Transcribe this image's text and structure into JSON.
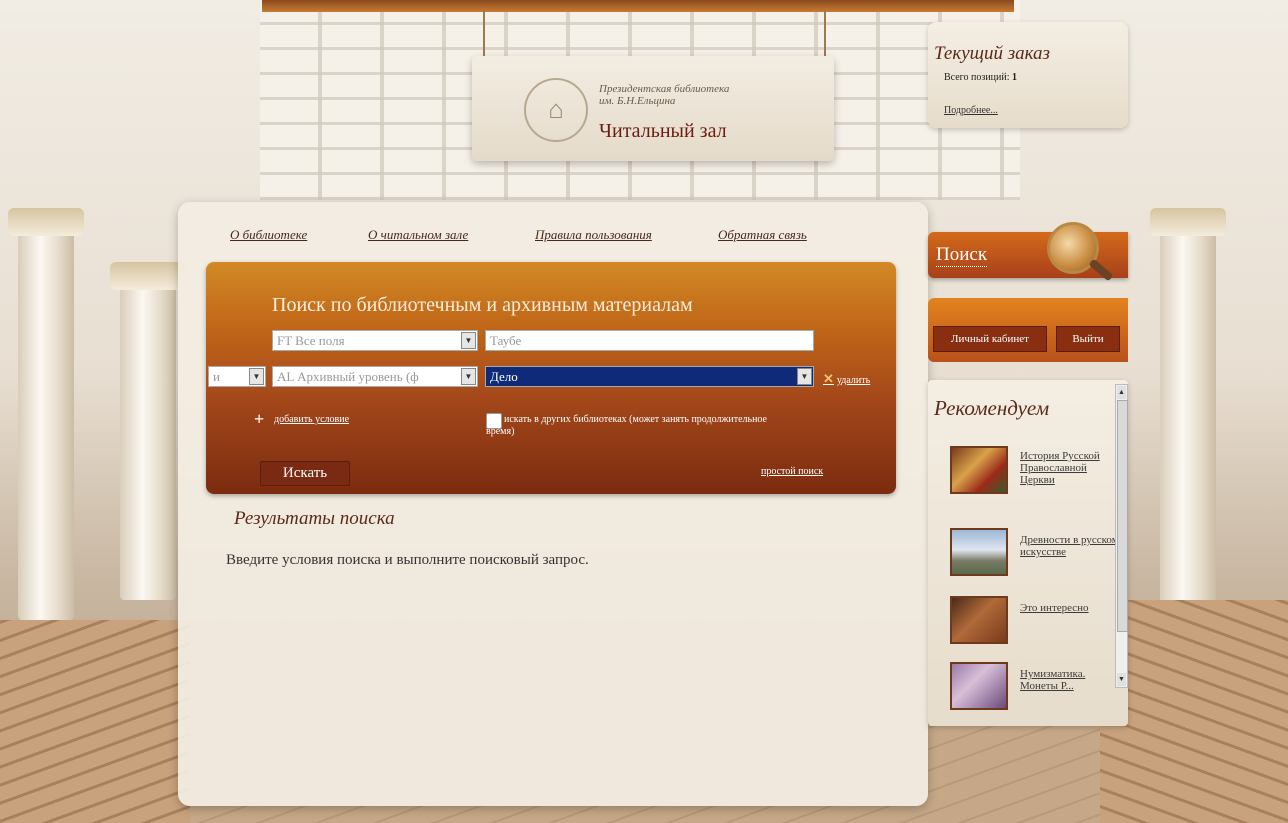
{
  "sign": {
    "subtitle_line1": "Президентская библиотека",
    "subtitle_line2": "им. Б.Н.Ельцина",
    "title": "Читальный зал"
  },
  "order": {
    "title": "Текущий заказ",
    "count_label": "Всего позиций:",
    "count_value": "1",
    "more_link": "Подробнее..."
  },
  "nav": {
    "items": [
      "О библиотеке",
      "О читальном зале",
      "Правила пользования",
      "Обратная связь"
    ]
  },
  "search": {
    "title": "Поиск по библиотечным и архивным материалам",
    "row1": {
      "field": "FT Все поля",
      "value": "Таубе"
    },
    "row2": {
      "operator": "и",
      "field": "AL Архивный уровень (ф",
      "value": "Дело"
    },
    "delete_link": "удалить",
    "add_condition": "добавить условие",
    "other_libraries": "искать в других библиотеках (может занять продолжительное время)",
    "search_button": "Искать",
    "simple_search": "простой поиск"
  },
  "results": {
    "title": "Результаты поиска",
    "text": "Введите условия поиска и выполните поисковый запрос."
  },
  "right": {
    "search_tab": "Поиск",
    "account_button": "Личный кабинет",
    "logout_button": "Выйти",
    "recommend_title": "Рекомендуем",
    "recommend_items": [
      "История Русской Православной Церкви",
      "Древности в русском искусстве",
      "Это интересно",
      "Нумизматика. Монеты Р..."
    ]
  }
}
